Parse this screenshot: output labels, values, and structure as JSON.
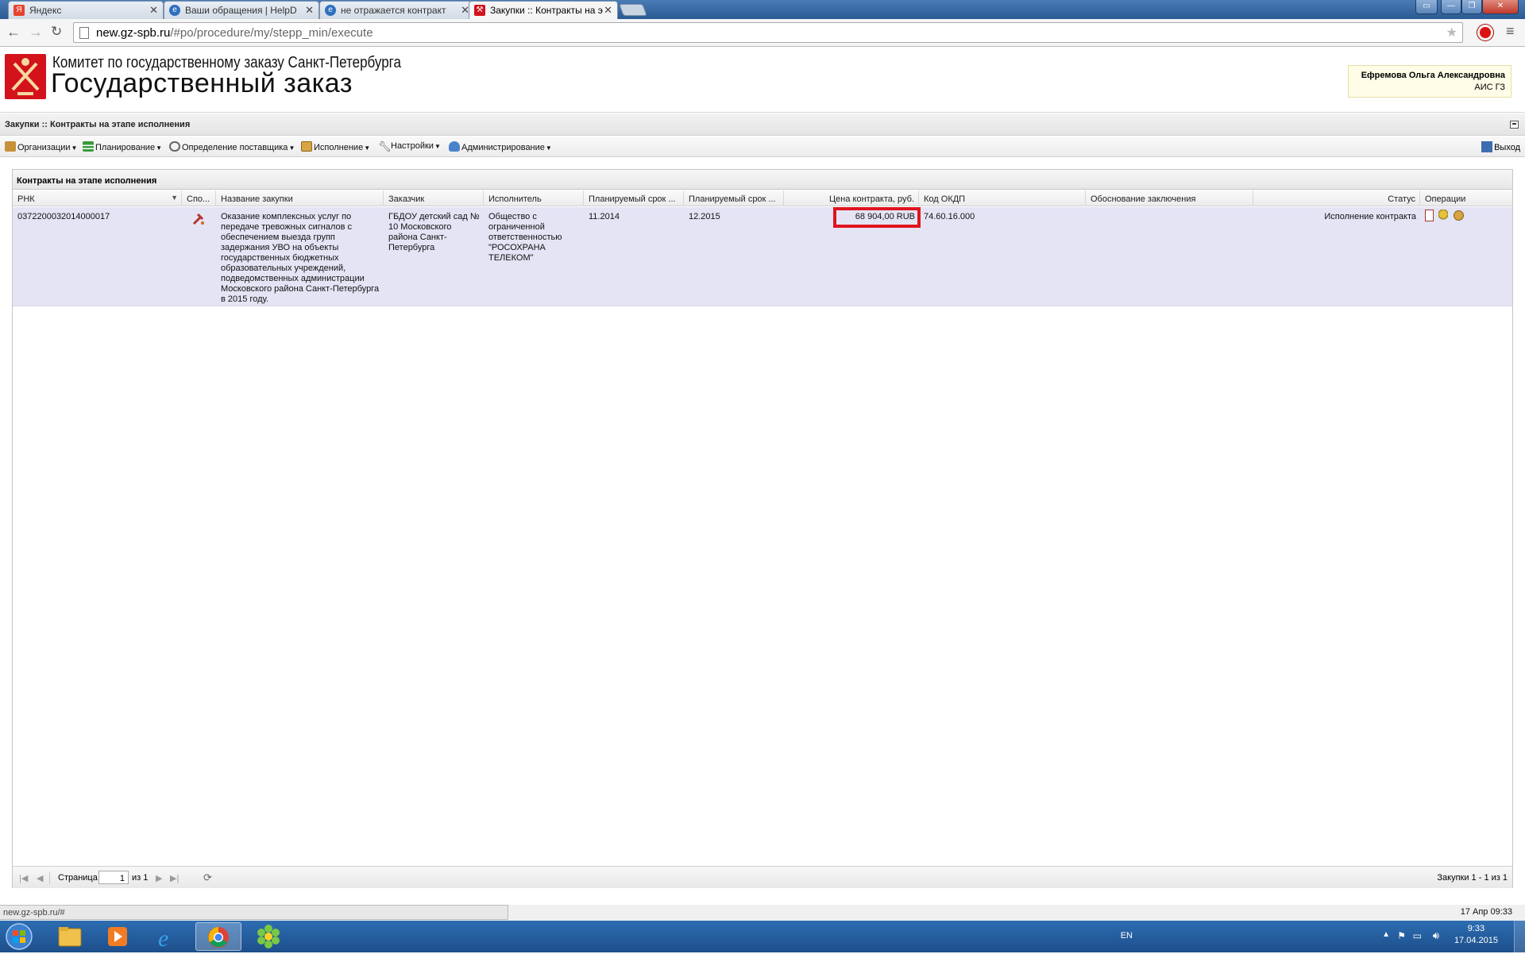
{
  "browser": {
    "tabs": [
      {
        "label": "Яндекс",
        "icon": "yandex-icon",
        "active": false
      },
      {
        "label": "Ваши обращения | HelpD",
        "icon": "globe-icon",
        "active": false
      },
      {
        "label": "не отражается контракт",
        "icon": "globe-icon",
        "active": false
      },
      {
        "label": "Закупки :: Контракты на э",
        "icon": "emblem-icon",
        "active": true
      }
    ],
    "url_host": "new.gz-spb.ru",
    "url_path": "/#po/procedure/my/stepp_min/execute",
    "hover_url": "new.gz-spb.ru/#"
  },
  "header": {
    "org_line": "Комитет по государственному заказу Санкт-Петербурга",
    "system_title": "Государственный заказ",
    "user_name": "Ефремова Ольга Александровна",
    "user_system": "АИС ГЗ"
  },
  "panel": {
    "title": "Закупки :: Контракты на этапе исполнения"
  },
  "menu": {
    "items": [
      {
        "label": "Организации",
        "icon": "briefcase-icon"
      },
      {
        "label": "Планирование",
        "icon": "list-icon"
      },
      {
        "label": "Определение поставщика",
        "icon": "gears-icon"
      },
      {
        "label": "Исполнение",
        "icon": "folders-icon"
      },
      {
        "label": "Настройки",
        "icon": "wrench-icon"
      },
      {
        "label": "Администрирование",
        "icon": "user-icon"
      }
    ],
    "logout": "Выход"
  },
  "grid": {
    "title": "Контракты на этапе исполнения",
    "columns": [
      "РНК",
      "Спо...",
      "Название закупки",
      "Заказчик",
      "Исполнитель",
      "Планируемый срок ...",
      "Планируемый срок ...",
      "Цена контракта, руб.",
      "Код ОКДП",
      "Обоснование заключения",
      "Статус",
      "Операции"
    ],
    "rows": [
      {
        "rnk": "0372200032014000017",
        "method_icon": "hammer-icon",
        "name": "Оказание комплексных услуг по передаче тревожных сигналов с обеспечением выезда групп задержания УВО на объекты государственных бюджетных образовательных учреждений, подведомственных администрации Московского района Санкт-Петербурга в 2015 году.",
        "customer": "ГБДОУ детский сад № 10 Московского района Санкт-Петербурга",
        "supplier": "Общество с ограниченной ответственностью \"РОСОХРАНА ТЕЛЕКОМ\"",
        "plan_start": "11.2014",
        "plan_end": "12.2015",
        "price": "68 904,00 RUB",
        "okdp": "74.60.16.000",
        "justification": "",
        "status": "Исполнение контракта"
      }
    ]
  },
  "pager": {
    "page_label": "Страница",
    "page_value": "1",
    "of_label": "из 1",
    "summary": "Закупки 1 - 1 из 1"
  },
  "status_time": "17 Апр 09:33",
  "taskbar": {
    "lang": "EN",
    "time": "9:33",
    "date": "17.04.2015"
  }
}
